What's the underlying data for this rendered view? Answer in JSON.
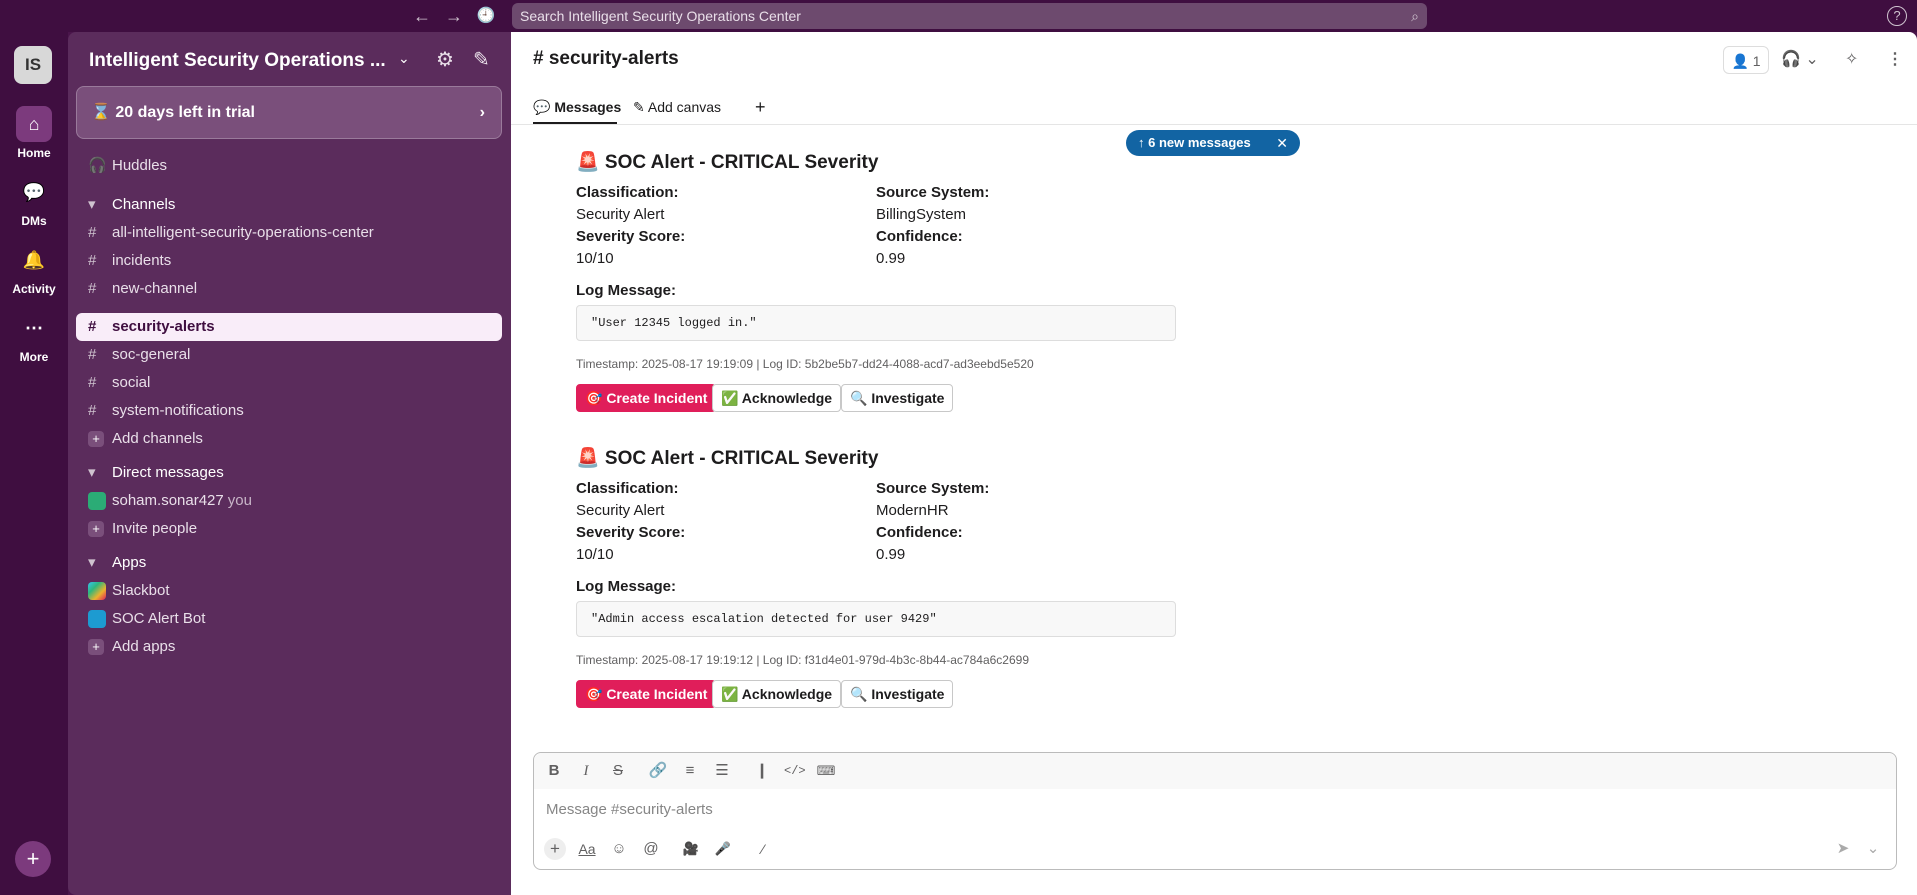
{
  "topbar": {
    "search_placeholder": "Search Intelligent Security Operations Center",
    "back_icon": "←",
    "forward_icon": "→",
    "history_icon": "🕘",
    "help_icon": "?"
  },
  "rail": {
    "workspace_initials": "IS",
    "items": [
      {
        "label": "Home",
        "icon": "⌂"
      },
      {
        "label": "DMs",
        "icon": "💬"
      },
      {
        "label": "Activity",
        "icon": "🔔"
      },
      {
        "label": "More",
        "icon": "⋯"
      }
    ]
  },
  "sidebar": {
    "workspace_name": "Intelligent Security Operations ...",
    "trial_text": "20 days left in trial",
    "huddles": "Huddles",
    "channels_header": "Channels",
    "channels": [
      "all-intelligent-security-operations-center",
      "incidents",
      "new-channel",
      "security-alerts",
      "soc-general",
      "social",
      "system-notifications"
    ],
    "add_channels": "Add channels",
    "dms_header": "Direct messages",
    "dm_user": "soham.sonar427",
    "dm_you": "you",
    "invite": "Invite people",
    "apps_header": "Apps",
    "apps": [
      "Slackbot",
      "SOC Alert Bot"
    ],
    "add_apps": "Add apps"
  },
  "channel": {
    "title": "# security-alerts",
    "member_count": "1",
    "tabs": {
      "messages": "Messages",
      "add_canvas": "Add canvas"
    },
    "new_messages": "↑ 6 new messages"
  },
  "alerts": [
    {
      "title": "🚨 SOC Alert - CRITICAL Severity",
      "classification_label": "Classification:",
      "classification": "Security Alert",
      "source_label": "Source System:",
      "source": "BillingSystem",
      "severity_label": "Severity Score:",
      "severity": "10/10",
      "confidence_label": "Confidence:",
      "confidence": "0.99",
      "log_label": "Log Message:",
      "log": "\"User 12345 logged in.\"",
      "meta": "Timestamp: 2025-08-17 19:19:09 | Log ID: 5b2be5b7-dd24-4088-acd7-ad3eebd5e520",
      "btn_incident": "🎯 Create Incident",
      "btn_ack": "✅ Acknowledge",
      "btn_investigate": "🔍 Investigate"
    },
    {
      "title": "🚨 SOC Alert - CRITICAL Severity",
      "classification_label": "Classification:",
      "classification": "Security Alert",
      "source_label": "Source System:",
      "source": "ModernHR",
      "severity_label": "Severity Score:",
      "severity": "10/10",
      "confidence_label": "Confidence:",
      "confidence": "0.99",
      "log_label": "Log Message:",
      "log": "\"Admin access escalation detected for user 9429\"",
      "meta": "Timestamp: 2025-08-17 19:19:12 | Log ID: f31d4e01-979d-4b3c-8b44-ac784a6c2699",
      "btn_incident": "🎯 Create Incident",
      "btn_ack": "✅ Acknowledge",
      "btn_investigate": "🔍 Investigate"
    }
  ],
  "composer": {
    "placeholder": "Message #security-alerts"
  },
  "colors": {
    "aubergine": "#4a154b",
    "sidebar": "#5b2c5c",
    "red_button": "#e01e5a",
    "new_msg_pill": "#1264a3"
  }
}
